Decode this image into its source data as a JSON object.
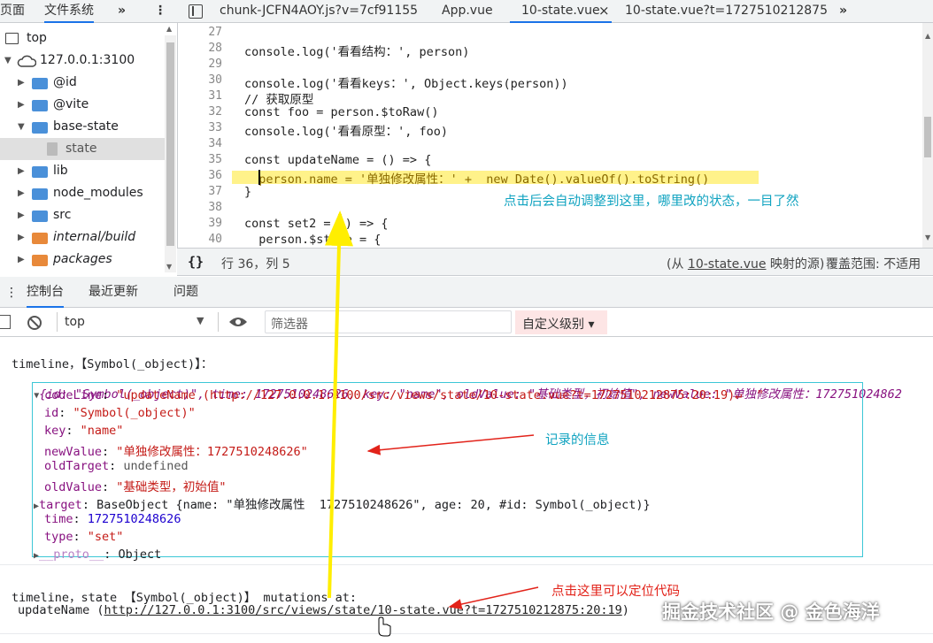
{
  "tabs": {
    "left": [
      "页面",
      "文件系统"
    ],
    "more_left": "»",
    "menu": "⋮",
    "files": [
      "chunk-JCFN4AOY.js?v=7cf91155",
      "App.vue",
      "10-state.vue",
      "10-state.vue?t=1727510212875"
    ],
    "close": "×",
    "more_right": "»"
  },
  "tree": [
    {
      "label": "top",
      "kind": "frame"
    },
    {
      "label": "127.0.0.1:3100",
      "kind": "cloud"
    },
    {
      "label": "@id",
      "kind": "folder"
    },
    {
      "label": "@vite",
      "kind": "folder"
    },
    {
      "label": "base-state",
      "kind": "folder"
    },
    {
      "label": "state",
      "kind": "file"
    },
    {
      "label": "lib",
      "kind": "folder"
    },
    {
      "label": "node_modules",
      "kind": "folder"
    },
    {
      "label": "src",
      "kind": "folder"
    },
    {
      "label": "internal/build",
      "kind": "folder-orange"
    },
    {
      "label": "packages",
      "kind": "folder-orange"
    }
  ],
  "code": [
    {
      "n": "27",
      "t": ""
    },
    {
      "n": "28",
      "t": "console.log('看看结构：', person)"
    },
    {
      "n": "29",
      "t": ""
    },
    {
      "n": "30",
      "t": "console.log('看看keys：', Object.keys(person))"
    },
    {
      "n": "31",
      "t": "// 获取原型"
    },
    {
      "n": "32",
      "t": "const foo = person.$toRaw()"
    },
    {
      "n": "33",
      "t": "console.log('看看原型：', foo)"
    },
    {
      "n": "34",
      "t": ""
    },
    {
      "n": "35",
      "t": "const updateName = () => {"
    },
    {
      "n": "36",
      "t": "  person.name = '单独修改属性：' +  new Date().valueOf().toString()"
    },
    {
      "n": "37",
      "t": "}"
    },
    {
      "n": "38",
      "t": ""
    },
    {
      "n": "39",
      "t": "const set2 = () => {"
    },
    {
      "n": "40",
      "t": "  person.$state = {"
    }
  ],
  "editor_note": "点击后会自动调整到这里，哪里改的状态，一目了然",
  "status": {
    "braces": "{}",
    "position": "行 36，列 5",
    "source_prefix": "(从 ",
    "source_link": "10-state.vue",
    "source_suffix": " 映射的源)",
    "coverage": "覆盖范围: 不适用"
  },
  "drawer_tabs": [
    "控制台",
    "最近更新",
    "问题"
  ],
  "drawer_close": "×",
  "console_toolbar": {
    "context": "top",
    "filter_placeholder": "筛选器",
    "levels": "自定义级别 ▾"
  },
  "console": {
    "line1": "timeline，【Symbol(_object)】：",
    "summary": "{id: \"Symbol(_object)\", time: 1727510248626, key: \"name\", oldValue: \"基础类型，初始值\", newValue: \"单独修改属性：172751024862",
    "props": [
      {
        "k": "codeLine",
        "v": "\"updateName (http://127.0.0.1:3100/src/views/state/10-state.vue?t=1727510212875:20:19)↵  \"",
        "type": "str"
      },
      {
        "k": "id",
        "v": "\"Symbol(_object)\"",
        "type": "str"
      },
      {
        "k": "key",
        "v": "\"name\"",
        "type": "str"
      },
      {
        "k": "newValue",
        "v": "\"单独修改属性：1727510248626\"",
        "type": "str"
      },
      {
        "k": "oldTarget",
        "v": "undefined",
        "type": "gray"
      },
      {
        "k": "oldValue",
        "v": "\"基础类型，初始值\"",
        "type": "str"
      },
      {
        "k": "target",
        "v": "BaseObject {name: \"单独修改属性  1727510248626\", age: 20, #id: Symbol(_object)}",
        "type": "obj"
      },
      {
        "k": "time",
        "v": "1727510248626",
        "type": "num"
      },
      {
        "k": "type",
        "v": "\"set\"",
        "type": "str"
      },
      {
        "k": "__proto__",
        "v": "Object",
        "type": "proto"
      }
    ],
    "line2": "timeline，state 【Symbol(_object)】 mutations at:",
    "line3_prefix": "updateName (",
    "line3_link": "http://127.0.0.1:3100/src/views/state/10-state.vue?t=1727510212875:20:19",
    "line3_suffix": ")"
  },
  "notes": {
    "recorded": "记录的信息",
    "click_here": "点击这里可以定位代码"
  },
  "watermark": "掘金技术社区 @ 金色海洋",
  "colors": {
    "cyan": "#3cc7d6",
    "red": "#e2231a",
    "yellow": "#ffee00",
    "highlight": "#fff28a"
  }
}
